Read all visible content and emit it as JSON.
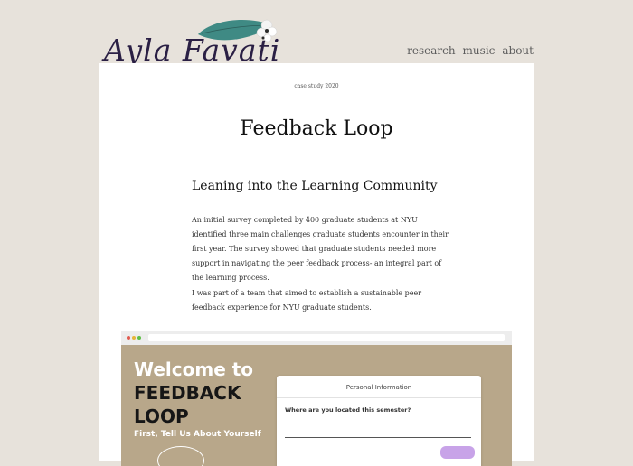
{
  "header": {
    "logo_text": "Ayla Favati",
    "nav": [
      "research",
      "music",
      "about"
    ]
  },
  "page": {
    "subtitle": "case study 2020",
    "title": "Feedback Loop",
    "section_heading": "Leaning into the Learning Community",
    "paragraphs": [
      "An initial survey completed by 400 graduate students at NYU identified three main challenges graduate students encounter in their first year. The survey showed that graduate students needed more support in navigating the peer feedback process- an integral part of the learning process.",
      "I was part of a team that aimed to establish a sustainable peer feedback experience for NYU graduate students."
    ]
  },
  "screenshot": {
    "welcome": "Welcome to",
    "brand": "FEEDBACK LOOP",
    "tagline": "First, Tell Us About Yourself",
    "form_title": "Personal Information",
    "question": "Where are you located this semester?"
  },
  "colors": {
    "background": "#e7e2db",
    "logo": "#2a1f44",
    "mockup_bg": "#b8a78a",
    "button": "#c8a3e8"
  }
}
